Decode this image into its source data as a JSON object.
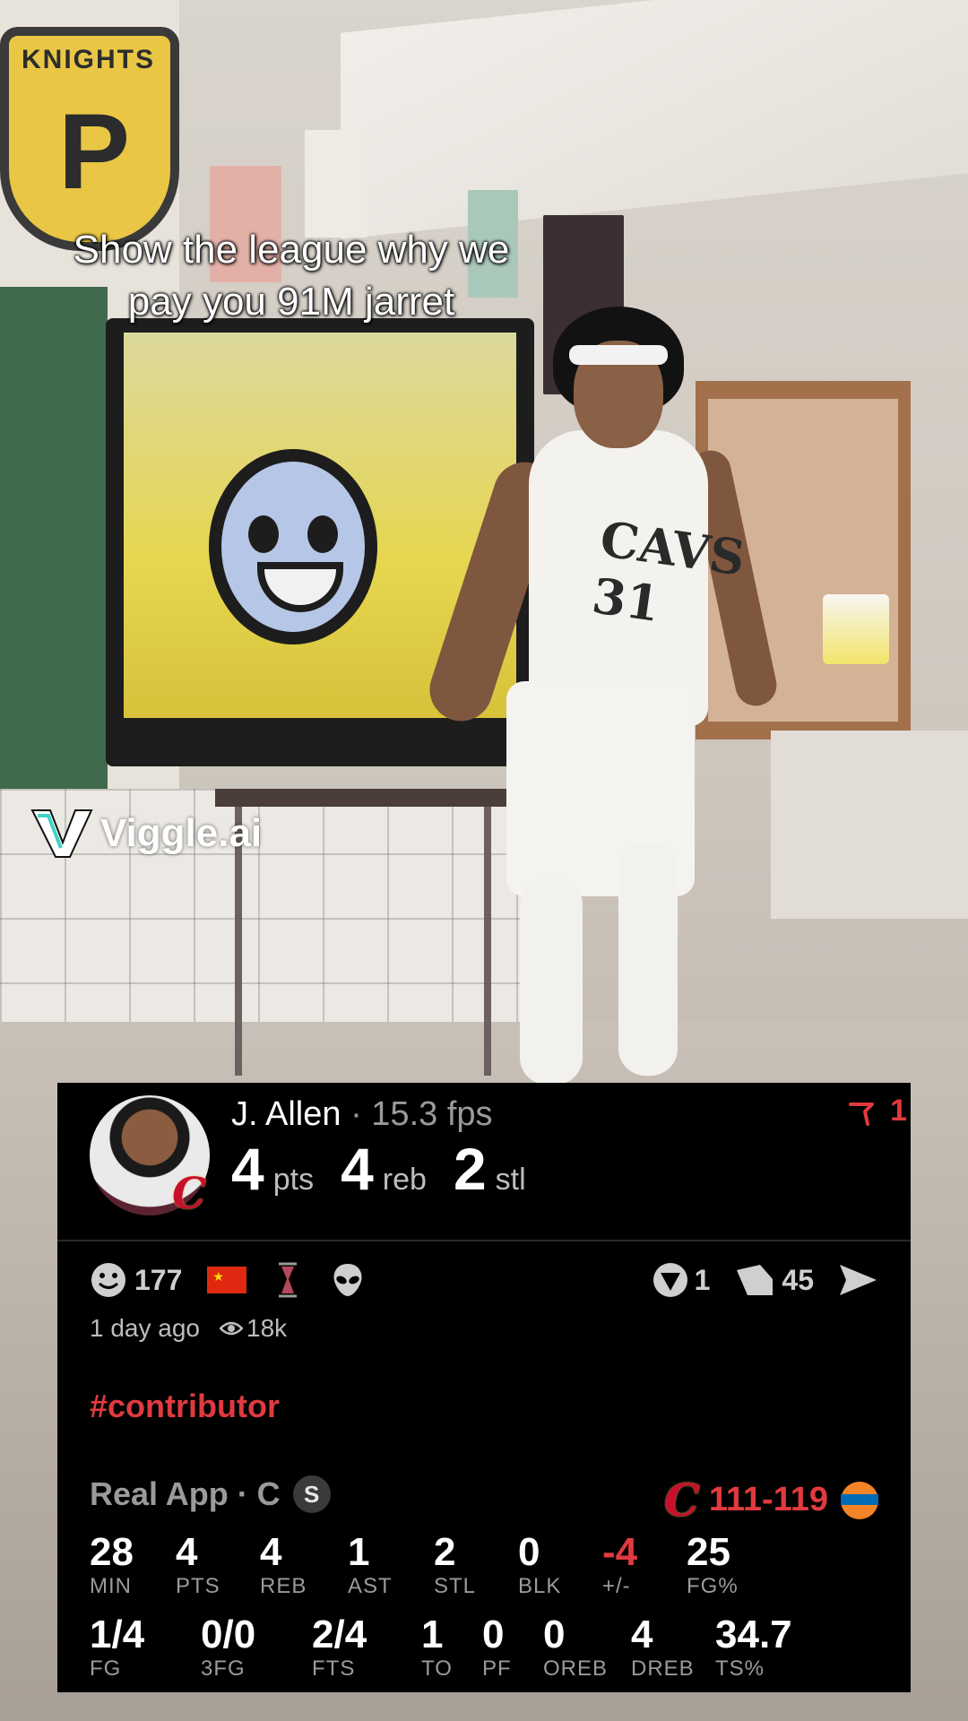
{
  "overlay": {
    "caption_lines": [
      "Show the league why we",
      "pay you 91M jarret"
    ],
    "watermark": "Viggle.ai"
  },
  "scene": {
    "shield_text": "KNIGHTS",
    "shield_letter": "P",
    "jersey_text": "CAVS 31"
  },
  "card": {
    "player_name": "J. Allen",
    "player_fps": " · 15.3 fps",
    "stats": [
      {
        "value": "4",
        "unit": "pts"
      },
      {
        "value": "4",
        "unit": "reb"
      },
      {
        "value": "2",
        "unit": "stl"
      }
    ],
    "flag_count": "1",
    "reactions": {
      "smiley_count": "177"
    },
    "actions": {
      "vote_count": "1",
      "comment_count": "45"
    },
    "meta": {
      "time": "1 day ago",
      "views": "18k"
    },
    "hashtag": "#contributor",
    "app": {
      "name": "Real App · C",
      "badge": "S"
    },
    "score": "111-119",
    "box_row1": [
      {
        "value": "28",
        "label": "MIN"
      },
      {
        "value": "4",
        "label": "PTS"
      },
      {
        "value": "4",
        "label": "REB"
      },
      {
        "value": "1",
        "label": "AST"
      },
      {
        "value": "2",
        "label": "STL"
      },
      {
        "value": "0",
        "label": "BLK"
      },
      {
        "value": "-4",
        "label": "+/-"
      },
      {
        "value": "25",
        "label": "FG%"
      }
    ],
    "box_row2": [
      {
        "value": "1/4",
        "label": "FG"
      },
      {
        "value": "0/0",
        "label": "3FG"
      },
      {
        "value": "2/4",
        "label": "FTS"
      },
      {
        "value": "1",
        "label": "TO"
      },
      {
        "value": "0",
        "label": "PF"
      },
      {
        "value": "0",
        "label": "OREB"
      },
      {
        "value": "4",
        "label": "DREB"
      },
      {
        "value": "34.7",
        "label": "TS%"
      }
    ]
  },
  "colors": {
    "accent_red": "#e03a3e",
    "card_bg": "#000000",
    "muted_text": "#9a9a9a"
  },
  "icons": [
    "smiley-icon",
    "china-flag-icon",
    "hourglass-icon",
    "alien-icon",
    "vote-icon",
    "comment-icon",
    "share-icon",
    "eye-icon",
    "flag-icon",
    "cavaliers-logo",
    "knicks-logo"
  ]
}
